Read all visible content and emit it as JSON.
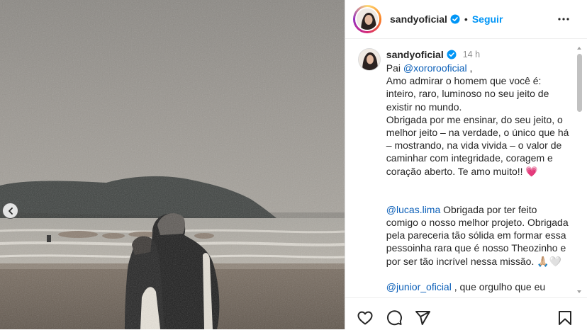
{
  "header": {
    "username": "sandyoficial",
    "separator": "•",
    "follow_label": "Seguir"
  },
  "caption": {
    "username": "sandyoficial",
    "time": "14 h",
    "line_pai": "Pai ",
    "mention_xororo": "@xororooficial",
    "after_mention": " ,",
    "para1": "Amo admirar o homem que você é: inteiro, raro, luminoso no seu jeito de existir no mundo.\nObrigada por me ensinar, do seu jeito, o melhor jeito – na verdade, o único que há – mostrando, na vida vivida – o valor de caminhar com integridade, coragem e coração aberto. Te amo muito!! ",
    "heart_emoji": "💗",
    "mention_lucas": "@lucas.lima",
    "para2": " Obrigada por ter feito comigo o nosso melhor projeto. Obrigada pela pareceria tão sólida em formar essa pessoinha rara que é nosso Theozinho e por ser tão incrível nessa missão. ",
    "emoji_pray": "🙏🏼",
    "emoji_white_heart": "🤍",
    "mention_junior": "@junior_oficial",
    "para3": " , que orgulho que eu"
  },
  "icons": {
    "like": "heart-icon",
    "comment": "comment-icon",
    "share": "share-icon",
    "save": "bookmark-icon",
    "more": "more-options-icon",
    "verified": "verified-badge-icon",
    "prev": "chevron-left-icon"
  },
  "colors": {
    "accent": "#0095f6",
    "mention": "#0b5fb8",
    "text": "#262626",
    "muted": "#8e8e8e"
  }
}
